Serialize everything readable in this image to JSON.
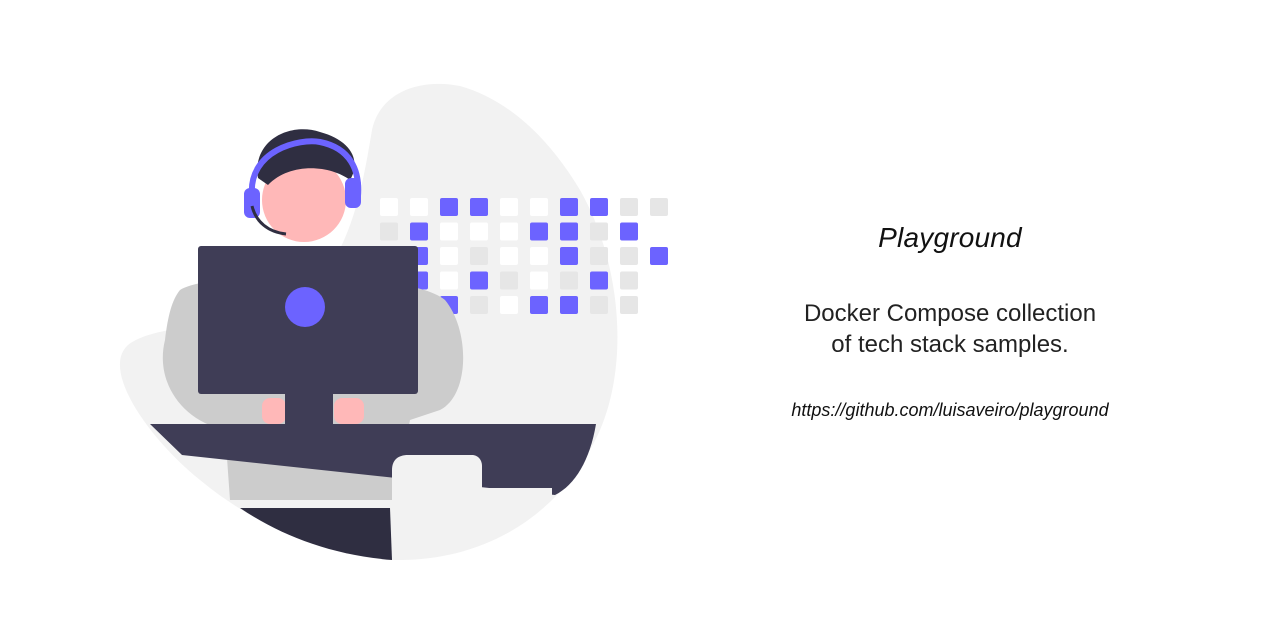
{
  "hero": {
    "title": "Playground",
    "description_line1": "Docker Compose collection",
    "description_line2": "of tech stack samples.",
    "url": "https://github.com/luisaveiro/playground"
  },
  "colors": {
    "accent": "#6c63ff",
    "dark": "#3f3d56",
    "skin": "#ffb8b8",
    "light_gray": "#f2f2f2",
    "mid_gray": "#cccccc",
    "grid_gray": "#e6e6e6"
  },
  "illustration": {
    "subject": "person with headset working at a computer monitor",
    "grid_pattern": [
      "wwppwwppgg",
      "gpwwwppgpw",
      "ppwgwwpggpp",
      "ppwpgwgpg",
      "gppgwppgg"
    ]
  }
}
